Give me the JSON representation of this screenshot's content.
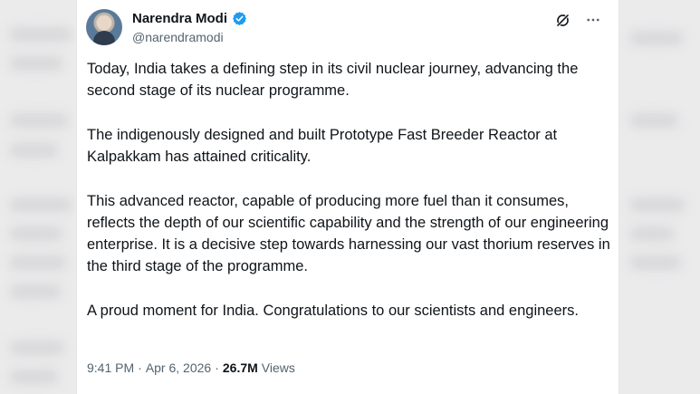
{
  "author": {
    "display_name": "Narendra Modi",
    "handle": "@narendramodi",
    "verified_icon": "verified-badge-icon",
    "accent": "#1d9bf0"
  },
  "actions": {
    "grok_icon": "grok-icon",
    "more_icon": "more-icon"
  },
  "post": {
    "paragraphs": [
      "Today, India takes a defining step in its civil nuclear journey, advancing the second stage of its nuclear programme.",
      "The indigenously designed and built Prototype Fast Breeder Reactor at Kalpakkam has attained criticality.",
      "This advanced reactor, capable of producing more fuel than it consumes, reflects the depth of our scientific capability and the strength of our engineering enterprise. It is a decisive step towards harnessing our vast thorium reserves in the third stage of the programme.",
      "A proud moment for India. Congratulations to our scientists and engineers."
    ]
  },
  "meta": {
    "time": "9:41 PM",
    "separator1": "·",
    "date": "Apr 6, 2026",
    "separator2": "·",
    "views_count": "26.7M",
    "views_label": "Views"
  }
}
